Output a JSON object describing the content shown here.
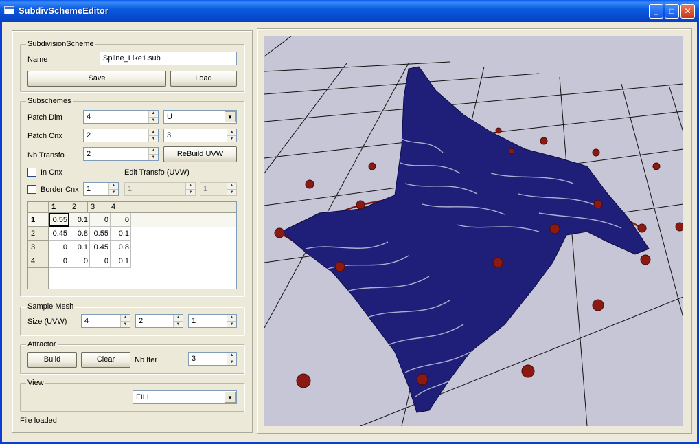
{
  "window": {
    "title": "SubdivSchemeEditor"
  },
  "scheme": {
    "group_title": "SubdivisionScheme",
    "name_label": "Name",
    "name_value": "Spline_Like1.sub",
    "save_label": "Save",
    "load_label": "Load"
  },
  "subschemes": {
    "group_title": "Subschemes",
    "patch_dim_label": "Patch Dim",
    "patch_dim_value": "4",
    "patch_dim_axis": "U",
    "patch_cnx_label": "Patch Cnx",
    "patch_cnx_value1": "2",
    "patch_cnx_value2": "3",
    "nb_transfo_label": "Nb Transfo",
    "nb_transfo_value": "2",
    "rebuild_label": "ReBuild UVW",
    "in_cnx_label": "In Cnx",
    "edit_transfo_label": "Edit Transfo (UVW)",
    "border_cnx_label": "Border Cnx",
    "border_cnx_value": "1",
    "edit_transfo_value1": "1",
    "edit_transfo_value2": "1"
  },
  "matrix": {
    "col_headers": [
      "1",
      "2",
      "3",
      "4"
    ],
    "rows": [
      {
        "header": "1",
        "cells": [
          "0.55",
          "0.1",
          "0",
          "0"
        ]
      },
      {
        "header": "2",
        "cells": [
          "0.45",
          "0.8",
          "0.55",
          "0.1"
        ]
      },
      {
        "header": "3",
        "cells": [
          "0",
          "0.1",
          "0.45",
          "0.8"
        ]
      },
      {
        "header": "4",
        "cells": [
          "0",
          "0",
          "0",
          "0.1"
        ]
      }
    ]
  },
  "sample_mesh": {
    "group_title": "Sample Mesh",
    "size_label": "Size (UVW)",
    "u": "4",
    "v": "2",
    "w": "1"
  },
  "attractor": {
    "group_title": "Attractor",
    "build_label": "Build",
    "clear_label": "Clear",
    "nb_iter_label": "Nb Iter",
    "nb_iter_value": "3"
  },
  "view": {
    "group_title": "View",
    "mode": "FILL"
  },
  "status": "File loaded",
  "colors": {
    "surface": "#1f1f7a",
    "control_points": "#8b1a12",
    "viewport_bg": "#c7c6d6",
    "title_bar": "#0a5ce0"
  }
}
